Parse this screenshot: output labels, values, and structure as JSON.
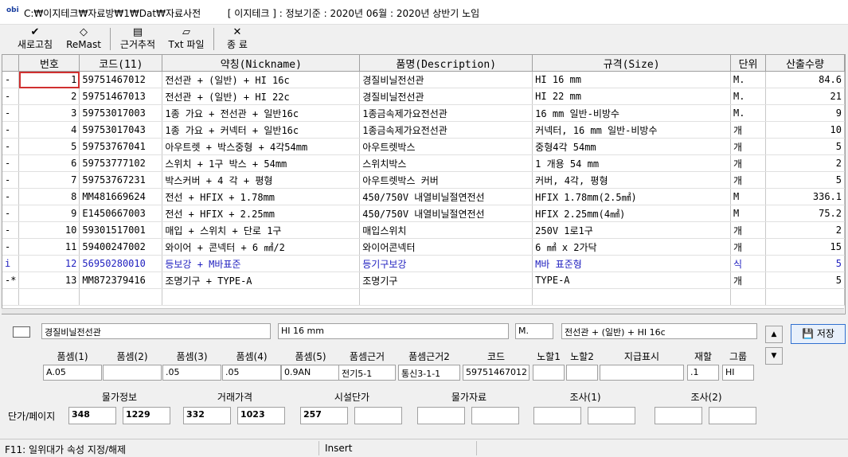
{
  "window": {
    "path": "C:₩이지테크₩자료방₩1₩Dat₩자료사전",
    "info": "[ 이지테크 ] : 정보기준 : 2020년 06월 : 2020년 상반기 노임",
    "app_icon": "obi"
  },
  "toolbar": {
    "refresh": "새로고침",
    "remast": "ReMast",
    "trace": "근거추적",
    "txt": "Txt 파일",
    "exit": "종  료"
  },
  "grid": {
    "headers": [
      "번호",
      "코드(11)",
      "약칭(Nickname)",
      "품명(Description)",
      "규격(Size)",
      "단위",
      "산출수량"
    ],
    "rows": [
      {
        "flag": "-",
        "no": "1",
        "code": "59751467012",
        "nick": "전선관 + (일반) + HI 16c",
        "desc": "경질비닐전선관",
        "size": "HI 16 mm",
        "unit": "M.",
        "qty": "84.6"
      },
      {
        "flag": "-",
        "no": "2",
        "code": "59751467013",
        "nick": "전선관 + (일반) + HI 22c",
        "desc": "경질비닐전선관",
        "size": "HI 22 mm",
        "unit": "M.",
        "qty": "21"
      },
      {
        "flag": "-",
        "no": "3",
        "code": "59753017003",
        "nick": "1종 가요 + 전선관 + 일반16c",
        "desc": "1종금속제가요전선관",
        "size": "16 mm 일반-비방수",
        "unit": "M.",
        "qty": "9"
      },
      {
        "flag": "-",
        "no": "4",
        "code": "59753017043",
        "nick": "1종 가요 + 커넥터 + 일반16c",
        "desc": "1종금속제가요전선관",
        "size": "커넥터, 16 mm 일반-비방수",
        "unit": "개",
        "qty": "10"
      },
      {
        "flag": "-",
        "no": "5",
        "code": "59753767041",
        "nick": "아우트렛 + 박스중형 + 4각54mm",
        "desc": "아우트렛박스",
        "size": "중형4각 54mm",
        "unit": "개",
        "qty": "5"
      },
      {
        "flag": "-",
        "no": "6",
        "code": "59753777102",
        "nick": "스위치 + 1구 박스 + 54mm",
        "desc": "스위치박스",
        "size": "1 개용 54 mm",
        "unit": "개",
        "qty": "2"
      },
      {
        "flag": "-",
        "no": "7",
        "code": "59753767231",
        "nick": "박스커버 + 4 각 + 평형",
        "desc": "아우트렛박스 커버",
        "size": "커버, 4각, 평형",
        "unit": "개",
        "qty": "5"
      },
      {
        "flag": "-",
        "no": "8",
        "code": "MM481669624",
        "nick": "전선 + HFIX + 1.78mm",
        "desc": "450/750V 내열비닐절연전선",
        "size": "HFIX 1.78mm(2.5㎟)",
        "unit": "M",
        "qty": "336.1"
      },
      {
        "flag": "-",
        "no": "9",
        "code": "E1450667003",
        "nick": "전선 + HFIX + 2.25mm",
        "desc": "450/750V 내열비닐절연전선",
        "size": "HFIX 2.25mm(4㎟)",
        "unit": "M",
        "qty": "75.2"
      },
      {
        "flag": "-",
        "no": "10",
        "code": "59301517001",
        "nick": "매입 + 스위치 + 단로 1구",
        "desc": "매입스위치",
        "size": "250V 1로1구",
        "unit": "개",
        "qty": "2"
      },
      {
        "flag": "-",
        "no": "11",
        "code": "59400247002",
        "nick": "와이어 + 콘넥터 + 6 ㎟/2",
        "desc": "와이어콘넥터",
        "size": "6 ㎟ x 2가닥",
        "unit": "개",
        "qty": "15"
      },
      {
        "flag": "i",
        "no": "12",
        "code": "56950280010",
        "nick": "등보강 + M바표준",
        "desc": "등기구보강",
        "size": "M바 표준형",
        "unit": "식",
        "qty": "5",
        "blue": true
      },
      {
        "flag": "-*",
        "no": "13",
        "code": "MM872379416",
        "nick": "조명기구 + TYPE-A",
        "desc": "조명기구",
        "size": "TYPE-A",
        "unit": "개",
        "qty": "5"
      }
    ]
  },
  "detail": {
    "desc": "경질비닐전선관",
    "size": "HI 16 mm",
    "unit": "M.",
    "nick": "전선관 + (일반) + HI 16c",
    "save_label": "저장",
    "labels": [
      "품셈(1)",
      "품셈(2)",
      "품셈(3)",
      "품셈(4)",
      "품셈(5)",
      "품셈근거",
      "품셈근거2",
      "코드",
      "노할1",
      "노할2",
      "지급표시",
      "재할",
      "그룹"
    ],
    "values": [
      "A.05",
      "",
      ".05",
      ".05",
      "0.9AN",
      "전기5-1",
      "통신3-1-1",
      "59751467012",
      "",
      "",
      "",
      ".1",
      "HI"
    ],
    "price_labels": [
      "물가정보",
      "거래가격",
      "시설단가",
      "물가자료",
      "조사(1)",
      "조사(2)"
    ],
    "row_label": "단가/페이지",
    "prices": [
      "348",
      "1229",
      "332",
      "1023",
      "257",
      "",
      "",
      "",
      "",
      "",
      "",
      ""
    ]
  },
  "status": {
    "hint": "F11: 일위대가 속성 지정/해제",
    "mode": "Insert"
  }
}
